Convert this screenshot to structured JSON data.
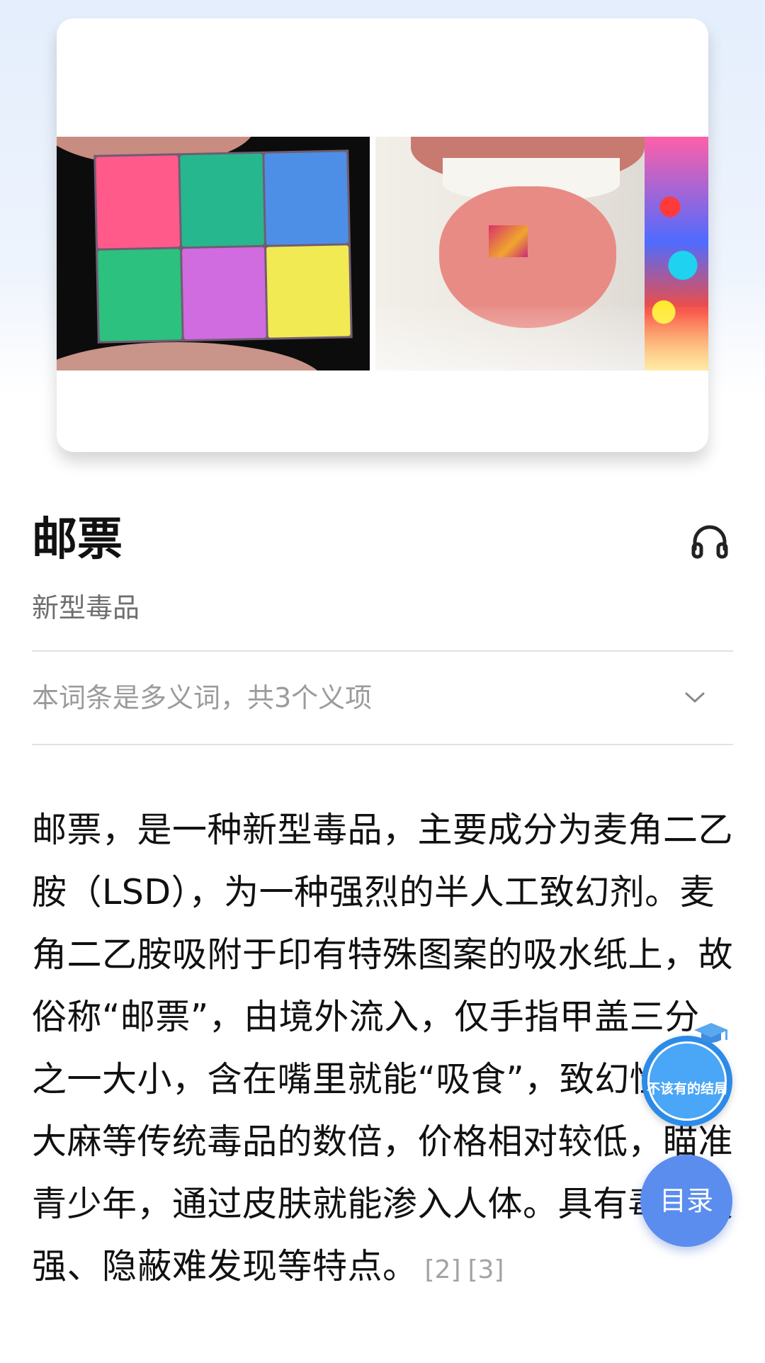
{
  "entry": {
    "title": "邮票",
    "subtitle": "新型毒品",
    "headphone_icon": "headphone-icon"
  },
  "polysemy": {
    "text": "本词条是多义词，共3个义项",
    "icon": "chevron-down-icon"
  },
  "paragraph": {
    "text": "邮票，是一种新型毒品，主要成分为麦角二乙胺（LSD），为一种强烈的半人工致幻剂。麦角二乙胺吸附于印有特殊图案的吸水纸上，故俗称“邮票”，由境外流入，仅手指甲盖三分之一大小，含在嘴里就能“吸食”，致幻性是大麻等传统毒品的数倍，价格相对较低，瞄准青少年，通过皮肤就能渗入人体。具有毒性极强、隐蔽难发现等特点。",
    "refs": [
      "[2]",
      "[3]"
    ]
  },
  "floating": {
    "badge_text": "不该有的结局",
    "toc_label": "目录"
  },
  "colors": {
    "toc_button": "#5b8def",
    "badge": "#2c8be8"
  }
}
